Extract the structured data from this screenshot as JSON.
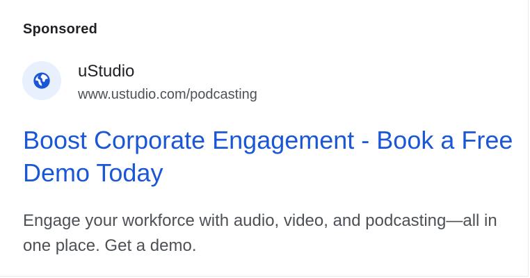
{
  "ad": {
    "sponsored_label": "Sponsored",
    "site_name": "uStudio",
    "site_url": "www.ustudio.com/podcasting",
    "headline": "Boost Corporate Engagement - Book a Free Demo Today",
    "description": "Engage your workforce with audio, video, and podcasting—all in one place. Get a demo.",
    "favicon_icon": "globe-icon"
  },
  "colors": {
    "headline": "#1a57d6",
    "icon": "#1a57d6",
    "icon_background": "#e8f0fe",
    "body_text": "#4d5156"
  }
}
